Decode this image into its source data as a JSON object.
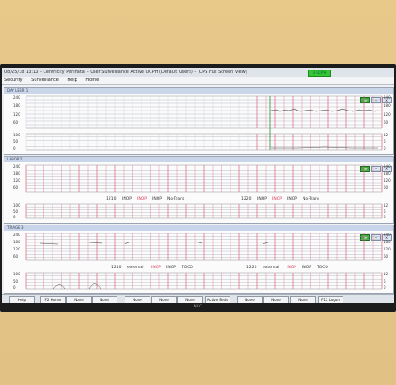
{
  "window": {
    "title": "08/25/18 13:10 - Centricity Perinatal - User Surveillance Active UCPH (Default Users) - [CPS Full Screen View]",
    "status_indicator": "3 UCPH"
  },
  "menu": [
    "Security",
    "Surveillance",
    "Help",
    "Home"
  ],
  "scale_labels": {
    "fhr": [
      "240",
      "180",
      "120",
      "60"
    ],
    "toco": [
      "100",
      "50",
      "0"
    ],
    "toco_right": [
      "12",
      "6",
      "0"
    ]
  },
  "panels": [
    {
      "label": "DAY LEBR 1",
      "annotations": []
    },
    {
      "label": "LABOR 2",
      "annotations": [
        {
          "time": "1210",
          "channels": [
            "INOP",
            "INOP",
            "INOP"
          ],
          "note": "No-Trans"
        },
        {
          "time": "1220",
          "channels": [
            "INOP",
            "INOP",
            "INOP"
          ],
          "note": "No-Trans"
        }
      ]
    },
    {
      "label": "TRIAGE 3",
      "annotations": [
        {
          "time": "1210",
          "channels": [
            "external",
            "INOP",
            "INOP"
          ],
          "note": "TOCO"
        },
        {
          "time": "1220",
          "channels": [
            "external",
            "INOP",
            "INOP"
          ],
          "note": "TOCO"
        }
      ]
    }
  ],
  "panel_controls": [
    "≫",
    "+",
    "×"
  ],
  "function_keys": [
    "Help",
    "F2 Home",
    "None",
    "None",
    "None",
    "None",
    "None",
    "Active Beds",
    "None",
    "None",
    "None",
    "F12 Logon"
  ],
  "device_brand": "NEC",
  "colors": {
    "grid_red": "#e0607a",
    "grid_gray": "#9aa0aa",
    "trace": "#444444",
    "inop_red": "#d63a5a"
  }
}
